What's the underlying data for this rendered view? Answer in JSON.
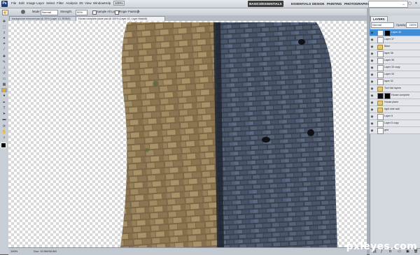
{
  "app": {
    "logo": "Ps",
    "screen_mode": "100%"
  },
  "menu": [
    "File",
    "Edit",
    "Image",
    "Layer",
    "Select",
    "Filter",
    "Analysis",
    "3D",
    "View",
    "Window",
    "Help"
  ],
  "workspaces": [
    "BASICS/ESSENTIALS",
    "ESSENTIALS",
    "DESIGN",
    "PAINTING",
    "PHOTOGRAPHY"
  ],
  "window_controls": [
    "_",
    "▢",
    "✕"
  ],
  "options": {
    "mode_label": "Mode:",
    "mode_value": "Normal",
    "strength_label": "Strength:",
    "strength_value": "50%",
    "sample_all": "Sample All Layers",
    "finger": "Finger Painting"
  },
  "tabs": [
    "background removed.psd @ 25% (Layer 13, RGB/8)",
    "House complete plane.psd @ 100% (Layer 42, Layer Mask/8)"
  ],
  "status": {
    "zoom": "100%",
    "doc": "Doc: 10.9M/34.5M"
  },
  "layers_panel": {
    "title": "LAYERS",
    "blend": "Normal",
    "opacity_label": "Opacity:",
    "opacity": "100%",
    "rows": [
      {
        "name": "Layer 42",
        "selected": true,
        "thumb": "light",
        "mask": true
      },
      {
        "name": "Layer 37",
        "thumb": "light"
      },
      {
        "name": "Base",
        "thumb": "folder"
      },
      {
        "name": "layer 36",
        "thumb": "light"
      },
      {
        "name": "Layer 35",
        "thumb": "light"
      },
      {
        "name": "Layer 33 copy",
        "thumb": "light"
      },
      {
        "name": "Layer 33",
        "thumb": "light"
      },
      {
        "name": "layer 32",
        "thumb": "light"
      },
      {
        "name": "Tool hist layers",
        "thumb": "folder"
      },
      {
        "name": "House complete",
        "thumb": "dark",
        "mask": true
      },
      {
        "name": "House plane",
        "thumb": "folder"
      },
      {
        "name": "right side wall",
        "thumb": "folder"
      },
      {
        "name": "Layer 5",
        "thumb": "light"
      },
      {
        "name": "Layer 5 copy",
        "thumb": "light"
      },
      {
        "name": "grid",
        "thumb": "light"
      }
    ]
  },
  "watermark": "pxleyes.com",
  "colors": {
    "selection_blue": "#3f8cd6",
    "stone_warm": "#8a7450",
    "stone_cool": "#4a5568"
  }
}
